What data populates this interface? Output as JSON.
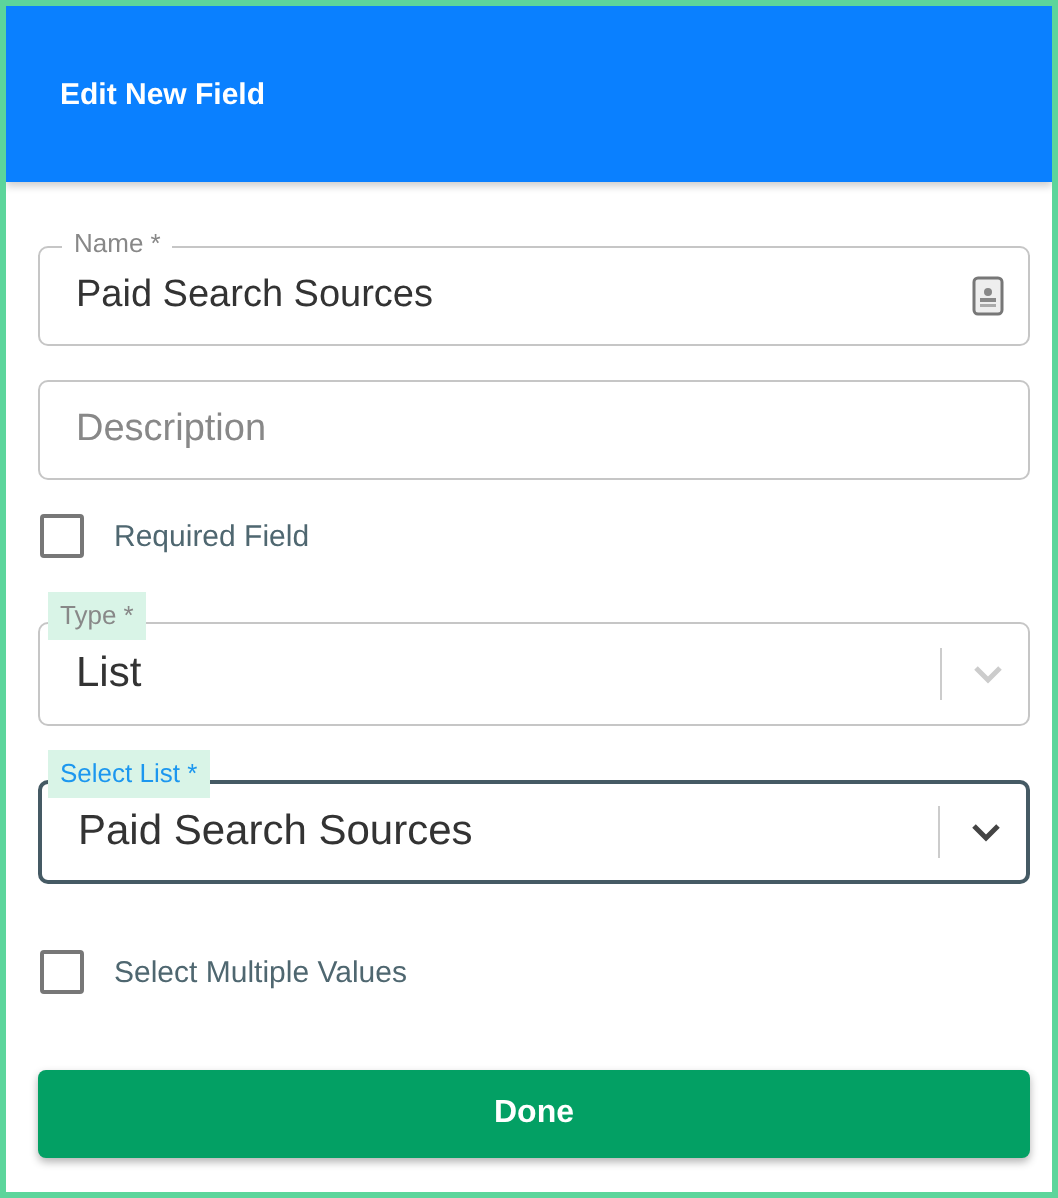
{
  "header": {
    "title": "Edit New Field"
  },
  "fields": [
    {
      "kind": "text",
      "label": "Name *",
      "value": "Paid Search Sources"
    },
    {
      "kind": "text",
      "placeholder": "Description"
    },
    {
      "kind": "checkbox",
      "label": "Required Field",
      "checked": false
    },
    {
      "kind": "select",
      "label": "Type *",
      "value": "List",
      "focused": false,
      "disabled": true
    },
    {
      "kind": "select",
      "label": "Select List *",
      "value": "Paid Search Sources",
      "focused": true,
      "disabled": false
    },
    {
      "kind": "checkbox",
      "label": "Select Multiple Values",
      "checked": false
    }
  ],
  "button": {
    "label": "Done"
  }
}
